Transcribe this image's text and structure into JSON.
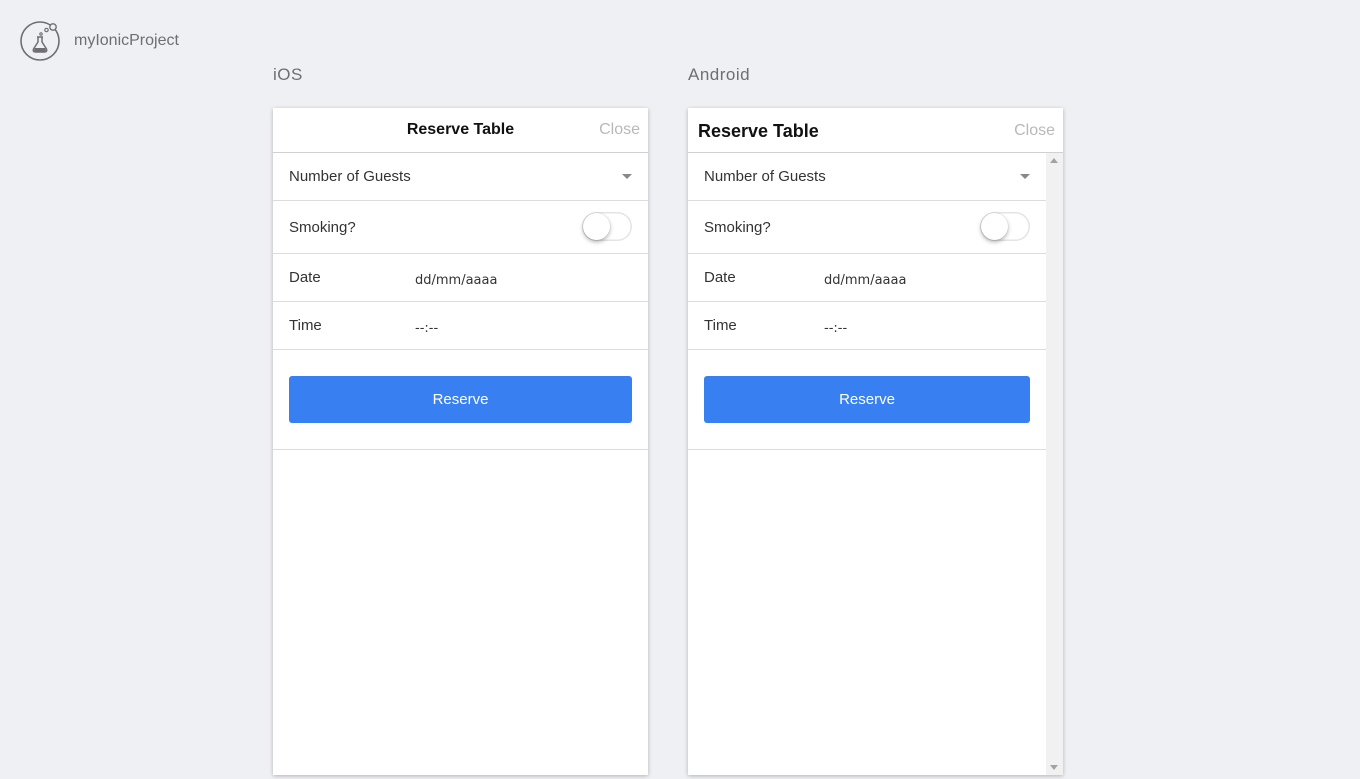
{
  "app": {
    "project_name": "myIonicProject"
  },
  "colors": {
    "background": "#eff0f4",
    "primary": "#3880f2",
    "close_text": "#b8b8bd"
  },
  "ios": {
    "platform_label": "iOS",
    "title": "Reserve Table",
    "close_label": "Close",
    "guests_label": "Number of Guests",
    "smoking_label": "Smoking?",
    "smoking_enabled": false,
    "date_label": "Date",
    "date_placeholder": "dd/mm/aaaa",
    "time_label": "Time",
    "time_placeholder": "--:--",
    "reserve_label": "Reserve"
  },
  "android": {
    "platform_label": "Android",
    "title": "Reserve Table",
    "close_label": "Close",
    "guests_label": "Number of Guests",
    "smoking_label": "Smoking?",
    "smoking_enabled": false,
    "date_label": "Date",
    "date_placeholder": "dd/mm/aaaa",
    "time_label": "Time",
    "time_placeholder": "--:--",
    "reserve_label": "Reserve"
  }
}
